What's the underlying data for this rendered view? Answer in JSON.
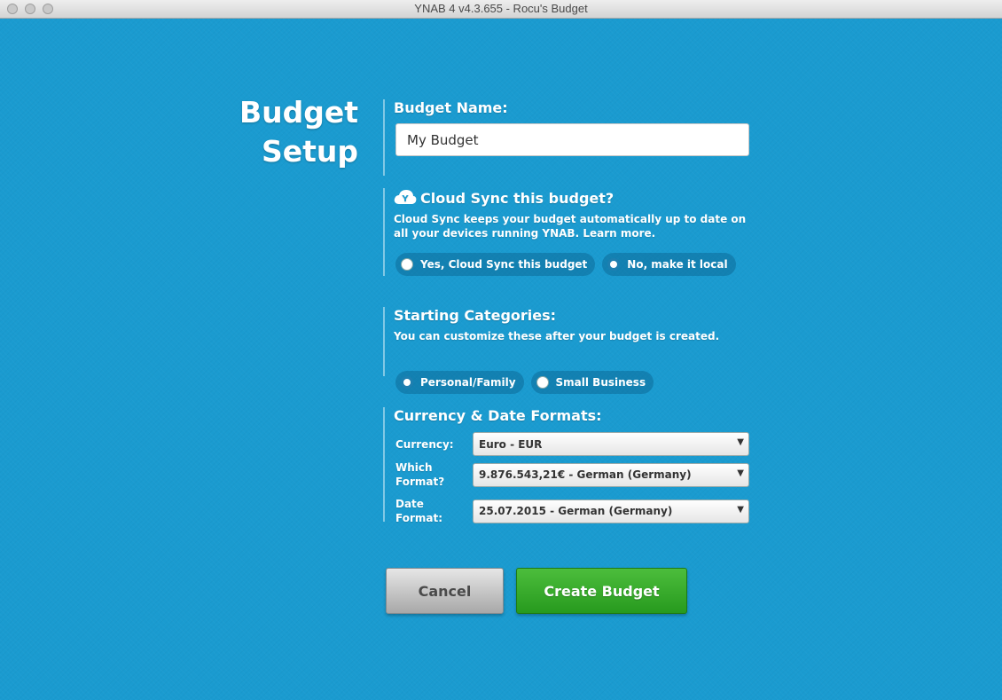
{
  "window": {
    "title": "YNAB 4 v4.3.655 - Rocu's Budget"
  },
  "heading": {
    "line1": "Budget",
    "line2": "Setup"
  },
  "budget_name": {
    "label": "Budget Name:",
    "value": "My Budget"
  },
  "cloud_sync": {
    "icon": "cloud-icon",
    "icon_letter": "Y",
    "title": "Cloud Sync this budget?",
    "description": "Cloud Sync keeps your budget automatically up to date on all your devices running YNAB. Learn more.",
    "options": [
      {
        "label": "Yes, Cloud Sync this budget",
        "selected": false
      },
      {
        "label": "No, make it local",
        "selected": true
      }
    ]
  },
  "starting_categories": {
    "title": "Starting Categories:",
    "description": "You can customize these after your budget is created.",
    "options": [
      {
        "label": "Personal/Family",
        "selected": true
      },
      {
        "label": "Small Business",
        "selected": false
      }
    ]
  },
  "formats": {
    "title": "Currency & Date Formats:",
    "currency_label": "Currency:",
    "currency_value": "Euro - EUR",
    "format_label": "Which Format?",
    "format_value": "9.876.543,21€ - German (Germany)",
    "date_label": "Date Format:",
    "date_value": "25.07.2015 - German (Germany)"
  },
  "buttons": {
    "cancel": "Cancel",
    "create": "Create Budget"
  },
  "colors": {
    "background": "#1a9bd0",
    "create_button": "#36ab2b",
    "cancel_button": "#c4c4c4"
  }
}
